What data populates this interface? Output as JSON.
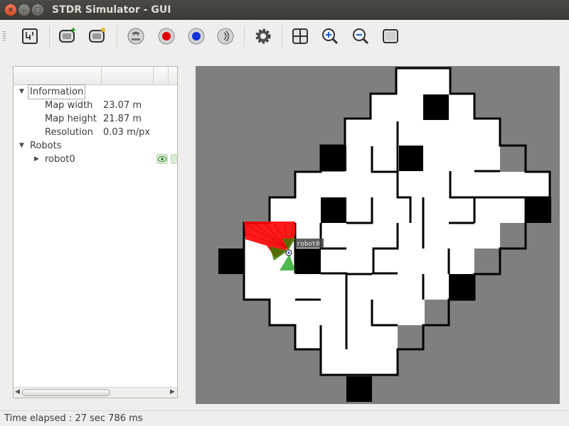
{
  "window": {
    "title": "STDR Simulator - GUI"
  },
  "toolbar": {
    "buttons": [
      {
        "name": "load-map-button",
        "icon": "map-icon"
      },
      {
        "name": "add-robot-button",
        "icon": "robot-add-icon"
      },
      {
        "name": "load-robot-button",
        "icon": "robot-load-icon"
      },
      {
        "name": "add-rfid-button",
        "icon": "rfid-icon"
      },
      {
        "name": "add-co2-source-button",
        "icon": "red-dot-icon"
      },
      {
        "name": "add-thermal-source-button",
        "icon": "blue-dot-icon"
      },
      {
        "name": "add-sound-source-button",
        "icon": "sound-icon"
      },
      {
        "name": "settings-button",
        "icon": "gear-icon"
      },
      {
        "name": "grid-button",
        "icon": "grid-icon"
      },
      {
        "name": "zoom-in-button",
        "icon": "zoom-in-icon"
      },
      {
        "name": "zoom-out-button",
        "icon": "zoom-out-icon"
      },
      {
        "name": "fit-view-button",
        "icon": "fit-window-icon"
      }
    ]
  },
  "tree": {
    "information": {
      "label": "Information",
      "items": [
        {
          "label": "Map width",
          "value": "23.07 m"
        },
        {
          "label": "Map height",
          "value": "21.87 m"
        },
        {
          "label": "Resolution",
          "value": "0.03 m/px"
        }
      ]
    },
    "robots": {
      "label": "Robots",
      "items": [
        {
          "label": "robot0"
        }
      ]
    }
  },
  "map": {
    "robot_label": "robot0"
  },
  "status": {
    "text": "Time elapsed : 27 sec 786 ms"
  },
  "colors": {
    "map_background": "#7f7f7f",
    "laser": "#ff0000",
    "sonar": "#2f8f2f"
  }
}
